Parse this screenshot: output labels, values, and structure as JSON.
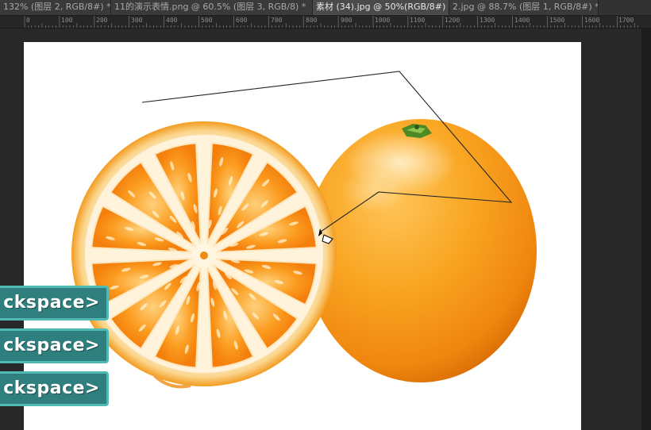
{
  "tabs": [
    {
      "label": "132% (图层 2, RGB/8#) *",
      "close": "×",
      "active": false
    },
    {
      "label": "11的演示表情.png @ 60.5% (图层 3, RGB/8) *",
      "close": "×",
      "active": false
    },
    {
      "label": "素材 (34).jpg @ 50%(RGB/8#)",
      "close": "×",
      "active": true
    },
    {
      "label": "2.jpg @ 88.7% (图层 1, RGB/8#) *",
      "close": "×",
      "active": false
    }
  ],
  "ruler": {
    "labels": [
      "0",
      "100",
      "200",
      "300",
      "400",
      "500",
      "600",
      "700",
      "800",
      "900",
      "1000",
      "1100",
      "1200",
      "1300",
      "1400",
      "1500",
      "1600",
      "1700"
    ]
  },
  "keystrokes": [
    {
      "text": "ckspace>"
    },
    {
      "text": "ckspace>"
    },
    {
      "text": "ckspace>"
    }
  ],
  "colors": {
    "workspace": "#282828",
    "canvas": "#ffffff",
    "keystroke_bg": "#2e7f7e",
    "keystroke_border": "#4fb9b3",
    "orange": "#f7931e"
  },
  "icons": {
    "cursor": "polygonal-lasso-cursor-icon"
  }
}
